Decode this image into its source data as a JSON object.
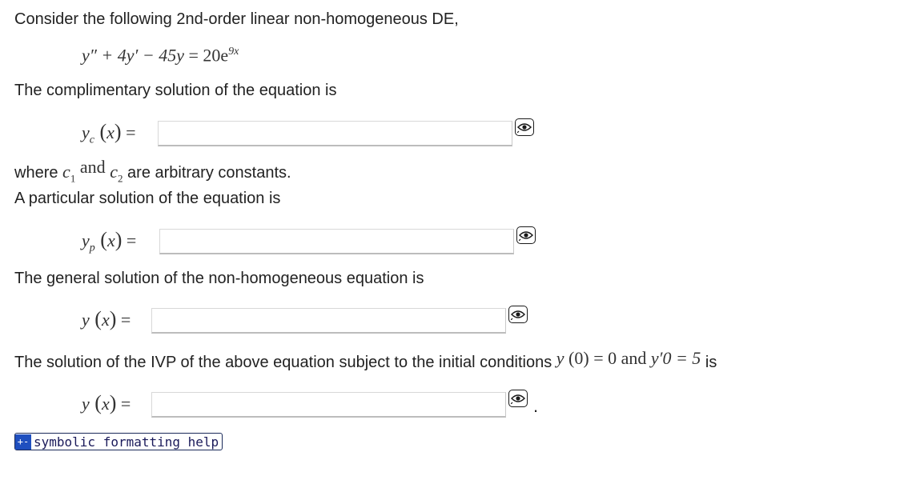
{
  "problem": {
    "intro": "Consider the following 2nd-order linear non-homogeneous DE,",
    "equation": {
      "lhs": "y″ + 4y′ − 45y",
      "eq": "=",
      "rhs_base": "20e",
      "rhs_exp": "9x"
    }
  },
  "complementary": {
    "prompt": "The complimentary solution of the equation is",
    "label": "y",
    "subscript": "c",
    "arg": "x",
    "input_value": "",
    "constants_prefix": "where",
    "constant1": "c",
    "constant1_sub": "1",
    "and_word": "and",
    "constant2": "c",
    "constant2_sub": "2",
    "constants_suffix": "are arbitrary constants."
  },
  "particular": {
    "prompt": "A particular solution of the equation is",
    "label": "y",
    "subscript": "p",
    "arg": "x",
    "input_value": ""
  },
  "general": {
    "prompt": "The general solution of the non-homogeneous equation is",
    "label": "y",
    "arg": "x",
    "input_value": ""
  },
  "ivp": {
    "prompt": "The solution of the IVP of the above equation subject to the initial conditions",
    "cond1_lhs": "y",
    "cond1_arg": "0",
    "cond1_rhs": "= 0",
    "and_word": "and",
    "cond2": "y′0 = 5",
    "suffix": "is",
    "label": "y",
    "arg": "x",
    "input_value": "",
    "terminal_period": "."
  },
  "help": {
    "plus_label": "+-",
    "label": "symbolic formatting help"
  },
  "icons": {
    "preview": "eye-preview-icon"
  }
}
